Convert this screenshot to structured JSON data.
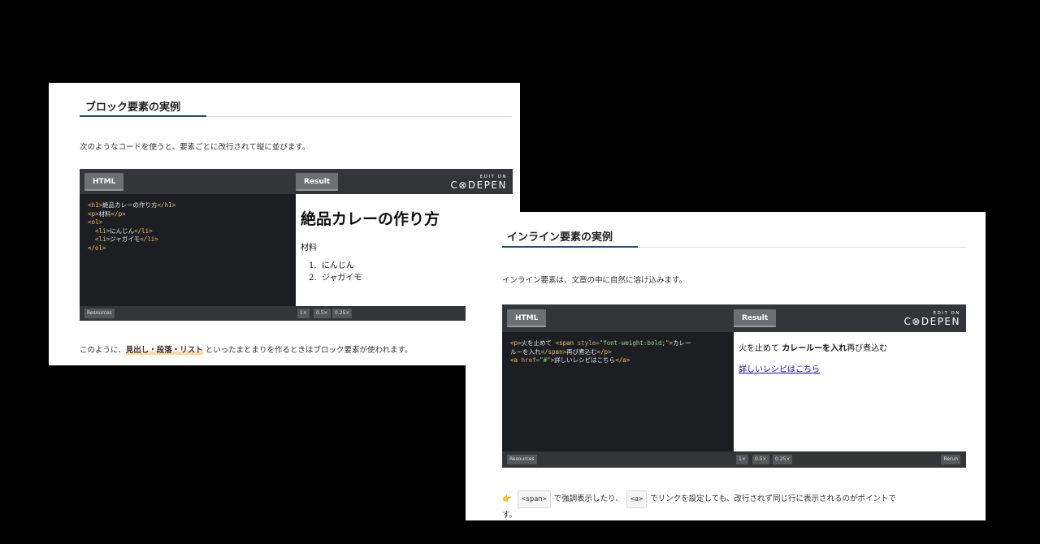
{
  "block_section": {
    "heading": "ブロック要素の実例",
    "intro": "次のようなコードを使うと、要素ごとに改行されて縦に並びます。",
    "pen": {
      "html_tab": "HTML",
      "result_tab": "Result",
      "logo_edit_on": "EDIT ON",
      "logo_brand": "C⊗DEPEN",
      "code_lines": [
        {
          "t1": "<h1>",
          "text": "絶品カレーの作り方",
          "t2": "</h1>"
        },
        {
          "t1": "<p>",
          "text": "材料",
          "t2": "</p>"
        },
        {
          "t1": "<ol>",
          "text": "",
          "t2": ""
        },
        {
          "t1": "  <li>",
          "text": "にんじん",
          "t2": "</li>"
        },
        {
          "t1": "  <li>",
          "text": "ジャガイモ",
          "t2": "</li>"
        },
        {
          "t1": "</ol>",
          "text": "",
          "t2": ""
        }
      ],
      "result": {
        "h1": "絶品カレーの作り方",
        "p": "材料",
        "items": [
          "にんじん",
          "ジャガイモ"
        ]
      },
      "resources_label": "Resources",
      "zoom": [
        "1×",
        "0.5×",
        "0.25×"
      ]
    },
    "outro_before": "このように、",
    "outro_highlight": "見出し・段落・リスト",
    "outro_after": "といったまとまりを作るときはブロック要素が使われます。"
  },
  "inline_section": {
    "heading": "インライン要素の実例",
    "intro": "インライン要素は、文章の中に自然に溶け込みます。",
    "pen": {
      "html_tab": "HTML",
      "result_tab": "Result",
      "logo_edit_on": "EDIT ON",
      "logo_brand": "C⊗DEPEN",
      "code": {
        "l1_tag_open": "<p>",
        "l1_text": "火を止めて ",
        "l1_span_open": "<span",
        "l1_attr": " style=",
        "l1_str": "\"font-weight:bold;\"",
        "l1_close": ">",
        "l1_text2": "カレー",
        "l2_text": "ルーを入れ",
        "l2_span_close": "</span>",
        "l2_text2": "再び煮込む",
        "l2_p_close": "</p>",
        "l3_a_open": "<a",
        "l3_attr": " href=",
        "l3_str": "\"#\"",
        "l3_close": ">",
        "l3_text": "詳しいレシピはこちら",
        "l3_a_close": "</a>"
      },
      "result": {
        "text_before": "火を止めて ",
        "text_bold": "カレールーを入れ",
        "text_after": "再び煮込む",
        "link": "詳しいレシピはこちら"
      },
      "resources_label": "Resources",
      "zoom": [
        "1×",
        "0.5×",
        "0.25×"
      ],
      "rerun_label": "Rerun"
    },
    "note_icon": "👉",
    "note_chip1": "<span>",
    "note_part1": "で強調表示したり、",
    "note_chip2": "<a>",
    "note_part2": "でリンクを設定しても、改行されず同じ行に表示されるのがポイントで",
    "note_line2": "す。"
  }
}
